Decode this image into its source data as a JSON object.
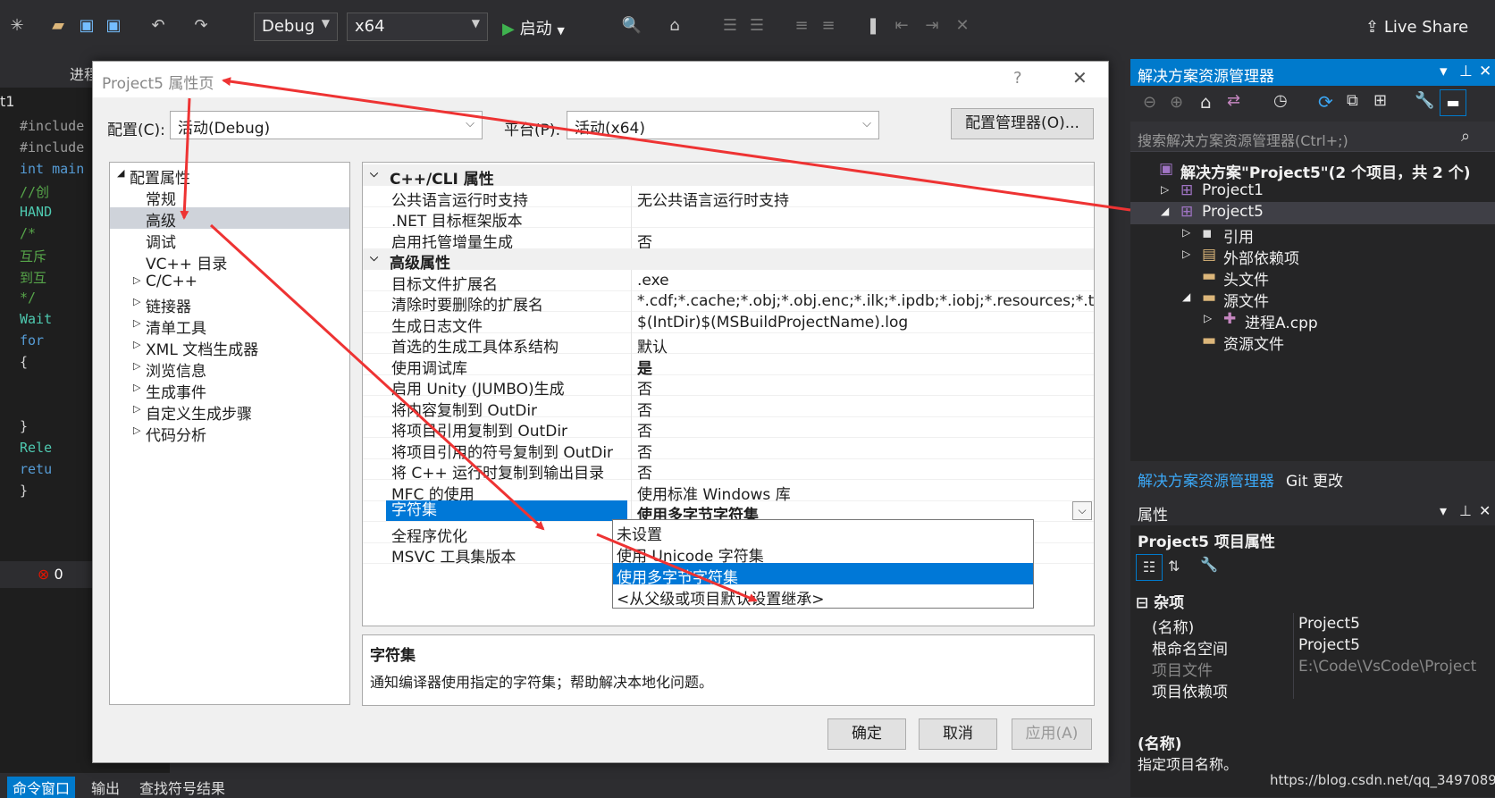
{
  "toolbar": {
    "config": "Debug",
    "platform": "x64",
    "start_label": "启动",
    "live_share": "Live Share"
  },
  "editor": {
    "tab_label": "进程",
    "file_short": "t1",
    "lines": [
      "#include",
      "#include",
      "int main",
      "//创",
      "HAND",
      "/*",
      "互斥",
      "到互",
      "*/",
      "Wait",
      "for",
      "{",
      "",
      "",
      "}",
      "Rele",
      "retu",
      "}"
    ],
    "error_count": "0"
  },
  "bottom_tabs": [
    "命令窗口",
    "输出",
    "查找符号结果"
  ],
  "solution_explorer": {
    "title": "解决方案资源管理器",
    "search_placeholder": "搜索解决方案资源管理器(Ctrl+;)",
    "tree": [
      {
        "label": "解决方案\"Project5\"(2 个项目，共 2 个)",
        "indent": 0,
        "icon": "solution-icon",
        "expander": ""
      },
      {
        "label": "Project1",
        "indent": 1,
        "icon": "project-icon",
        "expander": "▷"
      },
      {
        "label": "Project5",
        "indent": 1,
        "icon": "project-icon",
        "expander": "◢"
      },
      {
        "label": "引用",
        "indent": 2,
        "icon": "references-icon",
        "expander": "▷"
      },
      {
        "label": "外部依赖项",
        "indent": 2,
        "icon": "external-deps-icon",
        "expander": "▷"
      },
      {
        "label": "头文件",
        "indent": 2,
        "icon": "folder-icon",
        "expander": ""
      },
      {
        "label": "源文件",
        "indent": 2,
        "icon": "folder-icon",
        "expander": "◢"
      },
      {
        "label": "进程A.cpp",
        "indent": 3,
        "icon": "cpp-file-icon",
        "expander": "▷"
      },
      {
        "label": "资源文件",
        "indent": 2,
        "icon": "folder-icon",
        "expander": ""
      }
    ],
    "tabs": [
      "解决方案资源管理器",
      "Git 更改"
    ]
  },
  "properties_panel": {
    "title": "属性",
    "object": "Project5 项目属性",
    "category": "杂项",
    "rows": [
      {
        "name": "(名称)",
        "value": "Project5",
        "dim": false
      },
      {
        "name": "根命名空间",
        "value": "Project5",
        "dim": false
      },
      {
        "name": "项目文件",
        "value": "E:\\Code\\VsCode\\Project",
        "dim": true
      },
      {
        "name": "项目依赖项",
        "value": "",
        "dim": false
      }
    ],
    "desc_title": "(名称)",
    "desc_text": "指定项目名称。",
    "watermark": "https://blog.csdn.net/qq_34970891"
  },
  "dialog": {
    "title": "Project5 属性页",
    "help": "?",
    "close": "✕",
    "config_label": "配置(C):",
    "config_value": "活动(Debug)",
    "platform_label": "平台(P):",
    "platform_value": "活动(x64)",
    "config_manager": "配置管理器(O)...",
    "tree": [
      {
        "label": "配置属性",
        "indent": 0,
        "expander": "◢",
        "selected": false
      },
      {
        "label": "常规",
        "indent": 1,
        "expander": "",
        "selected": false
      },
      {
        "label": "高级",
        "indent": 1,
        "expander": "",
        "selected": true
      },
      {
        "label": "调试",
        "indent": 1,
        "expander": "",
        "selected": false
      },
      {
        "label": "VC++ 目录",
        "indent": 1,
        "expander": "",
        "selected": false
      },
      {
        "label": "C/C++",
        "indent": 1,
        "expander": "▷",
        "selected": false
      },
      {
        "label": "链接器",
        "indent": 1,
        "expander": "▷",
        "selected": false
      },
      {
        "label": "清单工具",
        "indent": 1,
        "expander": "▷",
        "selected": false
      },
      {
        "label": "XML 文档生成器",
        "indent": 1,
        "expander": "▷",
        "selected": false
      },
      {
        "label": "浏览信息",
        "indent": 1,
        "expander": "▷",
        "selected": false
      },
      {
        "label": "生成事件",
        "indent": 1,
        "expander": "▷",
        "selected": false
      },
      {
        "label": "自定义生成步骤",
        "indent": 1,
        "expander": "▷",
        "selected": false
      },
      {
        "label": "代码分析",
        "indent": 1,
        "expander": "▷",
        "selected": false
      }
    ],
    "grid": [
      {
        "cat": "C++/CLI 属性"
      },
      {
        "name": "公共语言运行时支持",
        "value": "无公共语言运行时支持"
      },
      {
        "name": ".NET 目标框架版本",
        "value": ""
      },
      {
        "name": "启用托管增量生成",
        "value": "否"
      },
      {
        "cat": "高级属性"
      },
      {
        "name": "目标文件扩展名",
        "value": ".exe"
      },
      {
        "name": "清除时要删除的扩展名",
        "value": "*.cdf;*.cache;*.obj;*.obj.enc;*.ilk;*.ipdb;*.iobj;*.resources;*.tlb;*"
      },
      {
        "name": "生成日志文件",
        "value": "$(IntDir)$(MSBuildProjectName).log"
      },
      {
        "name": "首选的生成工具体系结构",
        "value": "默认"
      },
      {
        "name": "使用调试库",
        "value": "是",
        "bold": true
      },
      {
        "name": "启用 Unity (JUMBO)生成",
        "value": "否"
      },
      {
        "name": "将内容复制到 OutDir",
        "value": "否"
      },
      {
        "name": "将项目引用复制到 OutDir",
        "value": "否"
      },
      {
        "name": "将项目引用的符号复制到 OutDir",
        "value": "否"
      },
      {
        "name": "将 C++ 运行时复制到输出目录",
        "value": "否"
      },
      {
        "name": "MFC 的使用",
        "value": "使用标准 Windows 库"
      },
      {
        "name": "字符集",
        "value": "使用多字节字符集",
        "selected": true,
        "bold": true
      },
      {
        "name": "全程序优化",
        "value": ""
      },
      {
        "name": "MSVC 工具集版本",
        "value": ""
      }
    ],
    "dropdown_options": [
      {
        "label": "未设置",
        "selected": false
      },
      {
        "label": "使用 Unicode 字符集",
        "selected": false
      },
      {
        "label": "使用多字节字符集",
        "selected": true
      },
      {
        "label": "<从父级或项目默认设置继承>",
        "selected": false
      }
    ],
    "desc_title": "字符集",
    "desc_text": "通知编译器使用指定的字符集；帮助解决本地化问题。",
    "ok": "确定",
    "cancel": "取消",
    "apply": "应用(A)"
  },
  "colors": {
    "accent": "#0078d7",
    "vs_blue": "#007acc",
    "annotation_red": "#ee3333"
  }
}
